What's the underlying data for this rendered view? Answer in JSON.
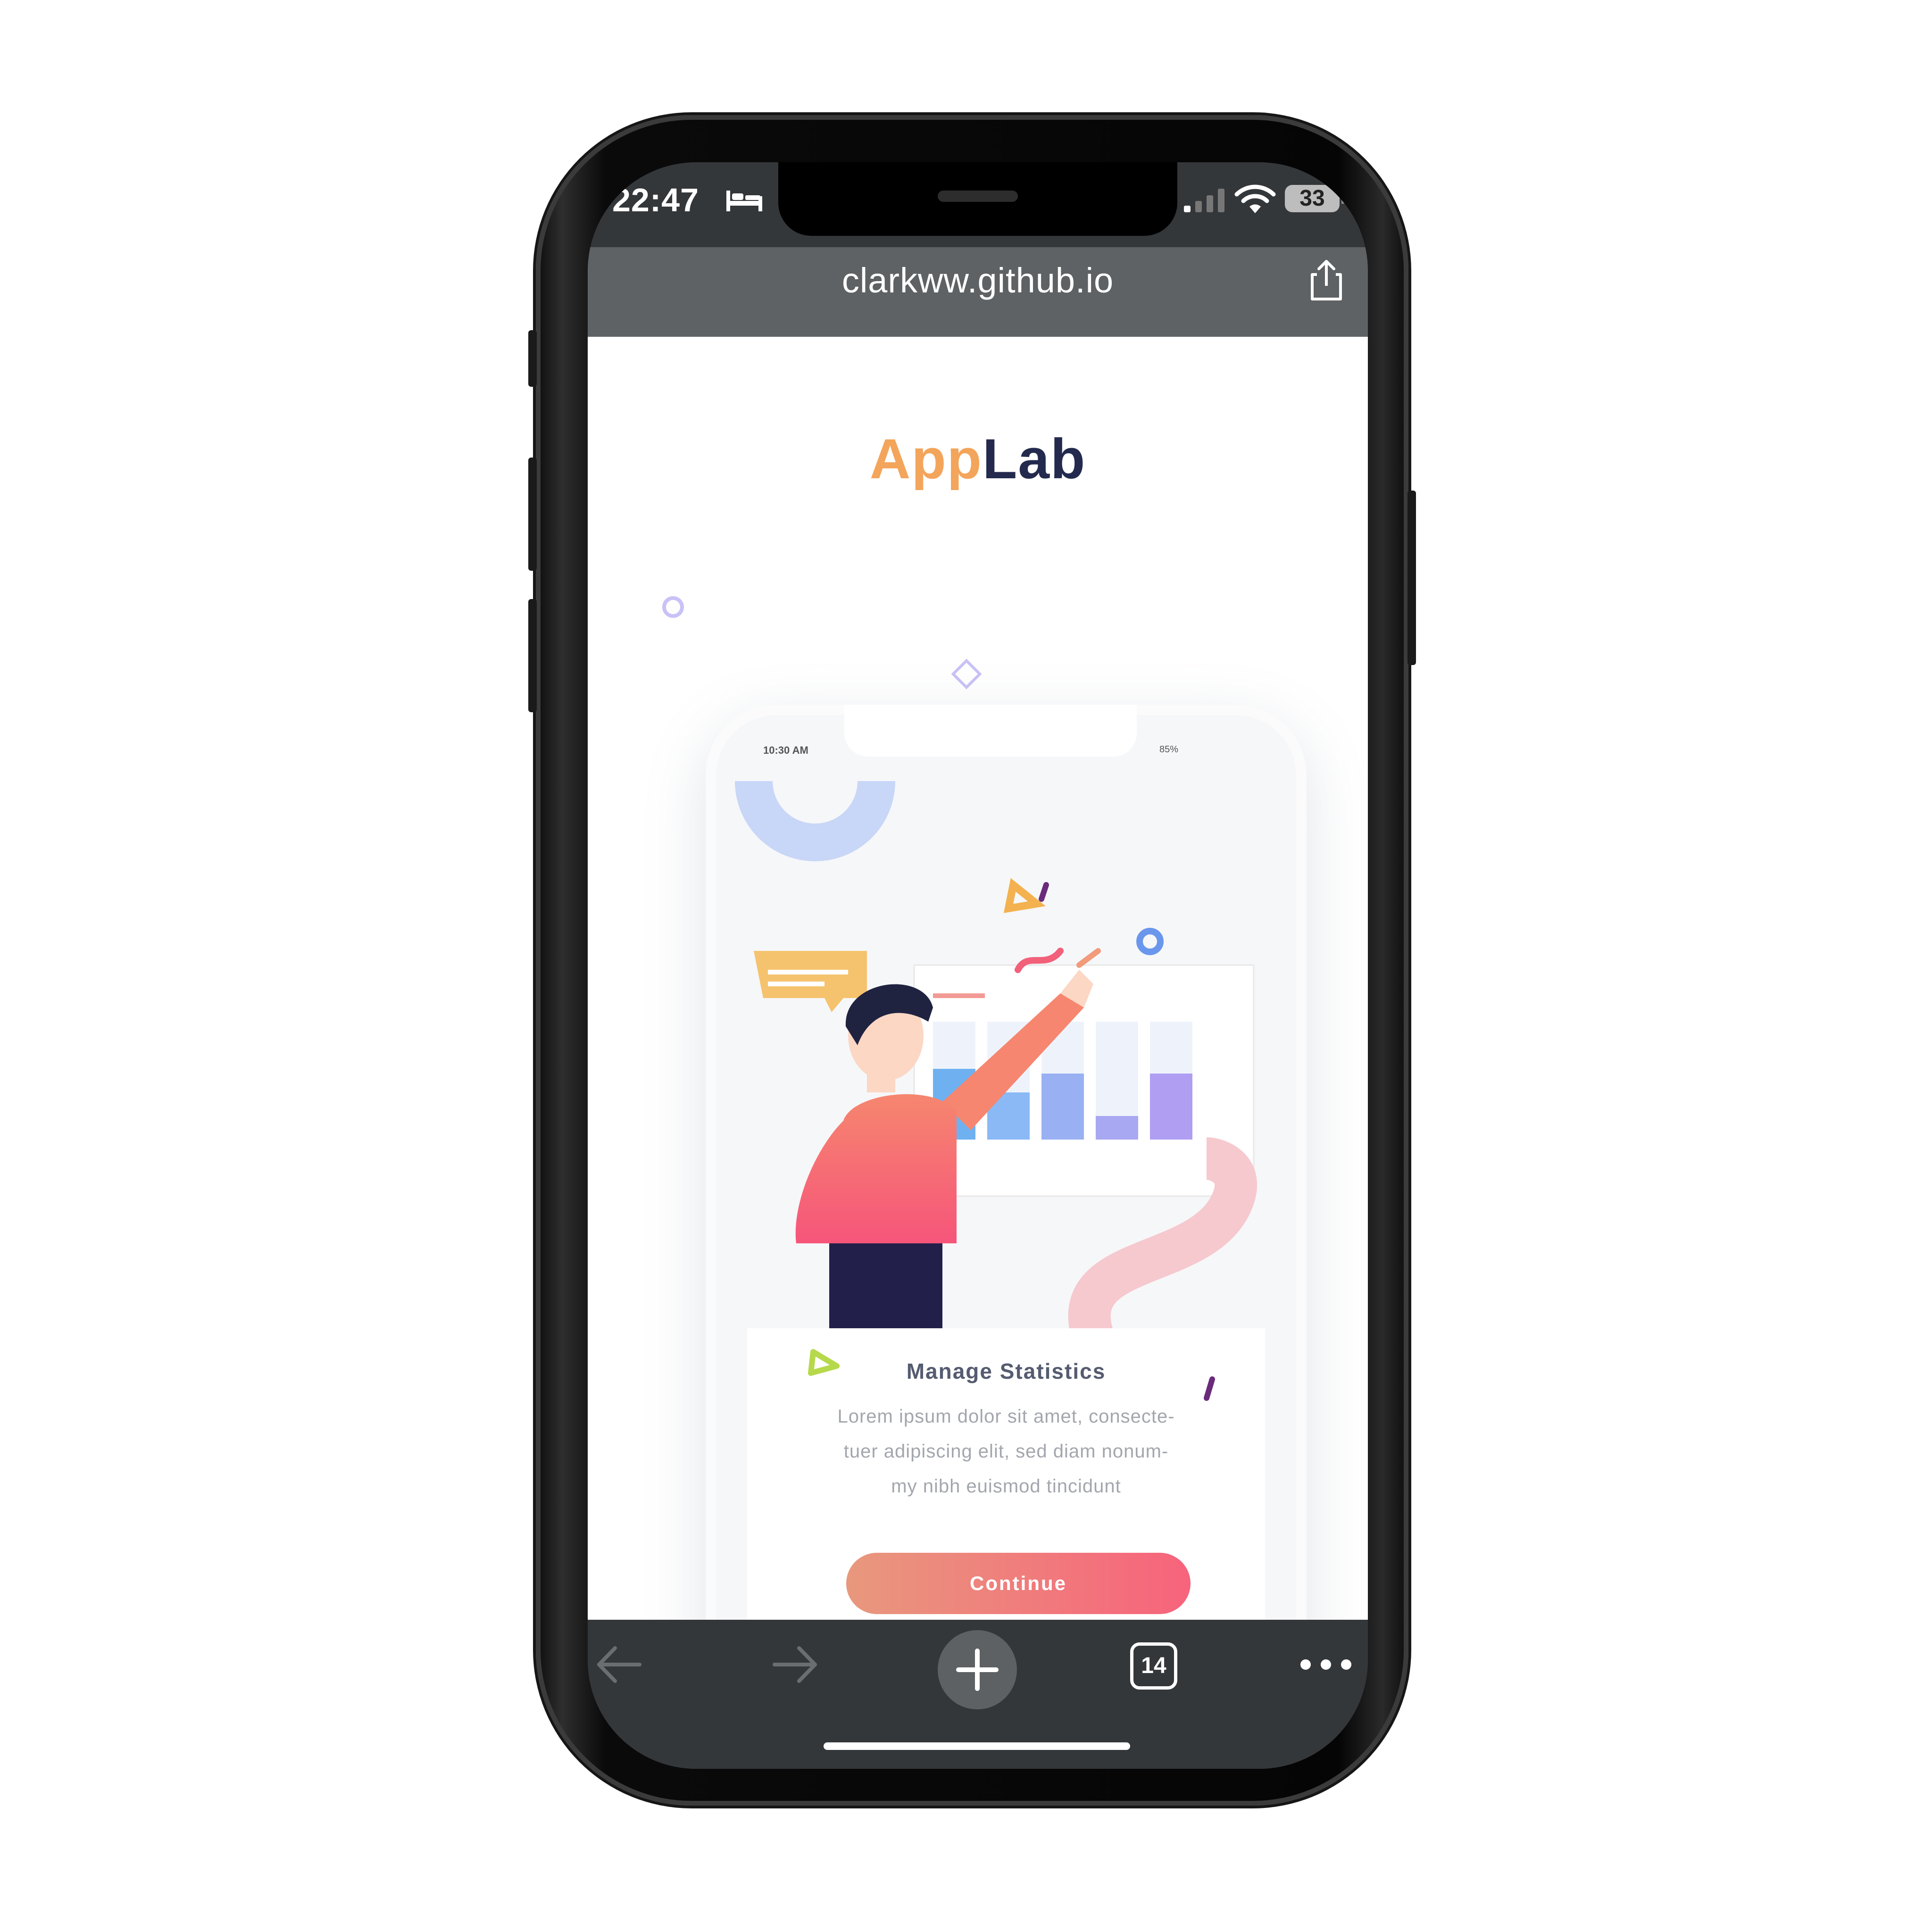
{
  "status_bar": {
    "time": "22:47",
    "battery": "33"
  },
  "browser": {
    "url": "clarkww.github.io",
    "tab_count": "14"
  },
  "page": {
    "brand_part1": "App",
    "brand_part2": "Lab",
    "mock": {
      "time": "10:30 AM",
      "battery": "85%",
      "title": "Manage Statistics",
      "body_line1": "Lorem ipsum dolor sit amet, consecte-",
      "body_line2": "tuer adipiscing elit, sed diam nonum-",
      "body_line3": "my nibh euismod tincidunt",
      "button_label": "Continue"
    }
  },
  "icons": {
    "bed": "bed-icon",
    "signal": "cellular-signal-icon",
    "wifi": "wifi-icon",
    "share": "share-icon",
    "back": "back-arrow-icon",
    "forward": "forward-arrow-icon",
    "new_tab": "plus-icon",
    "tabs": "tabs-icon",
    "more": "more-dots-icon"
  },
  "colors": {
    "brand_orange": "#f3a55b",
    "brand_navy": "#232a4e",
    "button_start": "#e8987d",
    "button_end": "#f7637c"
  }
}
